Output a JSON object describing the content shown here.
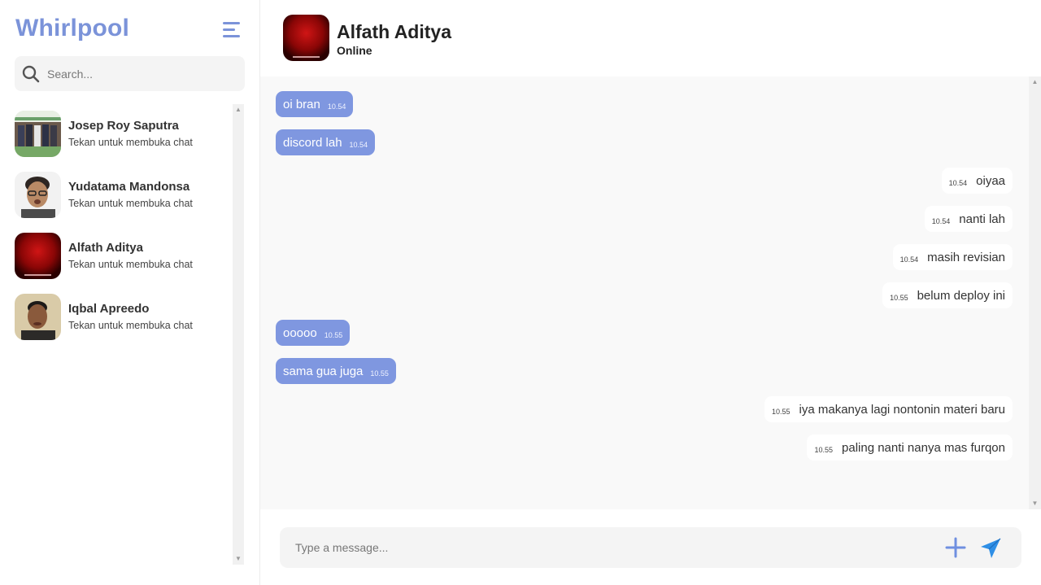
{
  "sidebar": {
    "brand": "Whirlpool",
    "search_placeholder": "Search...",
    "contacts": [
      {
        "name": "Josep Roy Saputra",
        "subtitle": "Tekan untuk membuka chat"
      },
      {
        "name": "Yudatama Mandonsa",
        "subtitle": "Tekan untuk membuka chat"
      },
      {
        "name": "Alfath Aditya",
        "subtitle": "Tekan untuk membuka chat"
      },
      {
        "name": "Iqbal Apreedo",
        "subtitle": "Tekan untuk membuka chat"
      }
    ]
  },
  "chat": {
    "name": "Alfath Aditya",
    "status": "Online",
    "composer_placeholder": "Type a message...",
    "messages": [
      {
        "direction": "in",
        "text": "oi bran",
        "time": "10.54"
      },
      {
        "direction": "in",
        "text": "discord lah",
        "time": "10.54"
      },
      {
        "direction": "out",
        "text": "oiyaa",
        "time": "10.54"
      },
      {
        "direction": "out",
        "text": "nanti lah",
        "time": "10.54"
      },
      {
        "direction": "out",
        "text": "masih revisian",
        "time": "10.54"
      },
      {
        "direction": "out",
        "text": "belum deploy ini",
        "time": "10.55"
      },
      {
        "direction": "in",
        "text": "ooooo",
        "time": "10.55"
      },
      {
        "direction": "in",
        "text": "sama gua juga",
        "time": "10.55"
      },
      {
        "direction": "out",
        "text": "iya makanya lagi nontonin materi baru",
        "time": "10.55"
      },
      {
        "direction": "out",
        "text": "paling nanti nanya mas furqon",
        "time": "10.55"
      }
    ]
  },
  "colors": {
    "accent": "#7b93d9",
    "incoming_bubble": "#7f97e0",
    "outgoing_bubble": "#ffffff",
    "chat_background": "#f9f9f9",
    "send_icon": "#2f8fe6"
  },
  "icons": {
    "menu": "hamburger-menu-icon",
    "search": "search-icon",
    "attach": "plus-icon",
    "send": "send-paper-plane-icon"
  }
}
